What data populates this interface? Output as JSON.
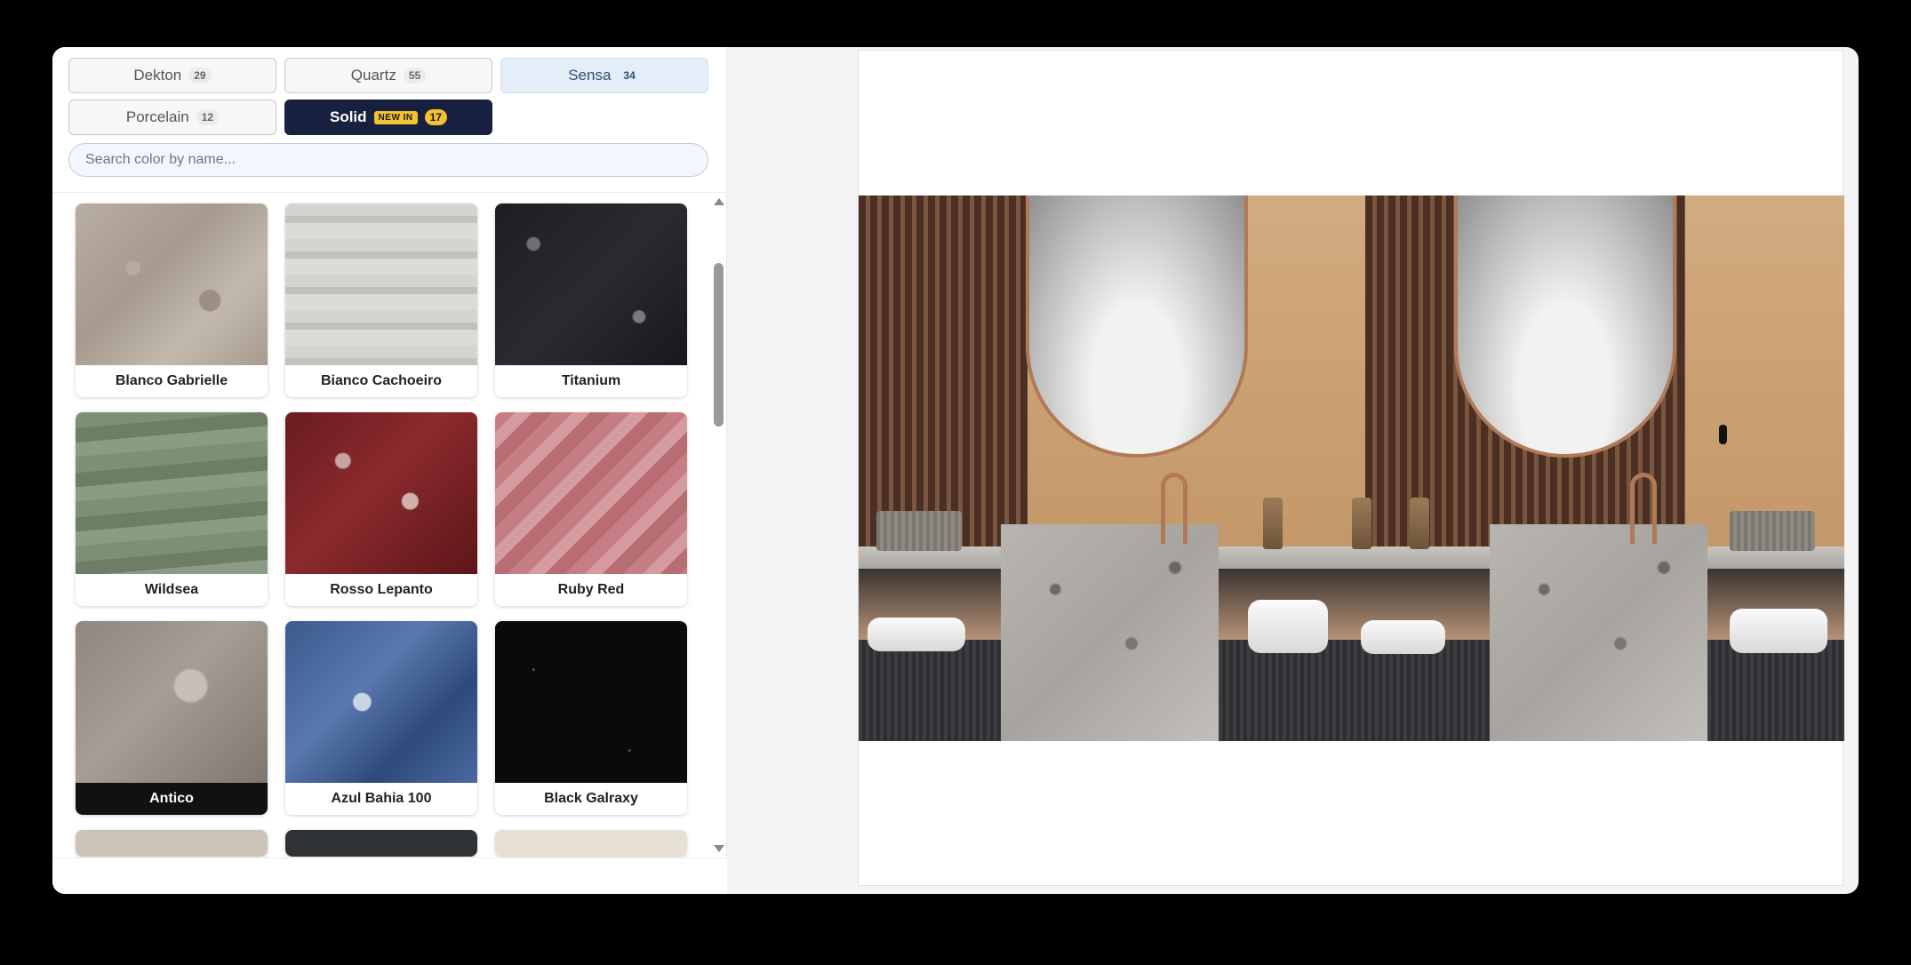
{
  "tabs": [
    {
      "label": "Dekton",
      "count": "29"
    },
    {
      "label": "Quartz",
      "count": "55"
    },
    {
      "label": "Sensa",
      "count": "34"
    },
    {
      "label": "Porcelain",
      "count": "12"
    },
    {
      "label": "Solid",
      "badge": "NEW IN",
      "count": "17"
    }
  ],
  "search": {
    "placeholder": "Search color by name..."
  },
  "swatches": [
    {
      "name": "Blanco Gabrielle"
    },
    {
      "name": "Bianco Cachoeiro"
    },
    {
      "name": "Titanium"
    },
    {
      "name": "Wildsea"
    },
    {
      "name": "Rosso Lepanto"
    },
    {
      "name": "Ruby Red"
    },
    {
      "name": "Antico",
      "selected": true
    },
    {
      "name": "Azul Bahia 100"
    },
    {
      "name": "Black Galraxy"
    }
  ],
  "colors": {
    "active_tab_dark": "#18203f",
    "active_tab_light": "#e4eef8",
    "new_badge": "#f2c230"
  }
}
